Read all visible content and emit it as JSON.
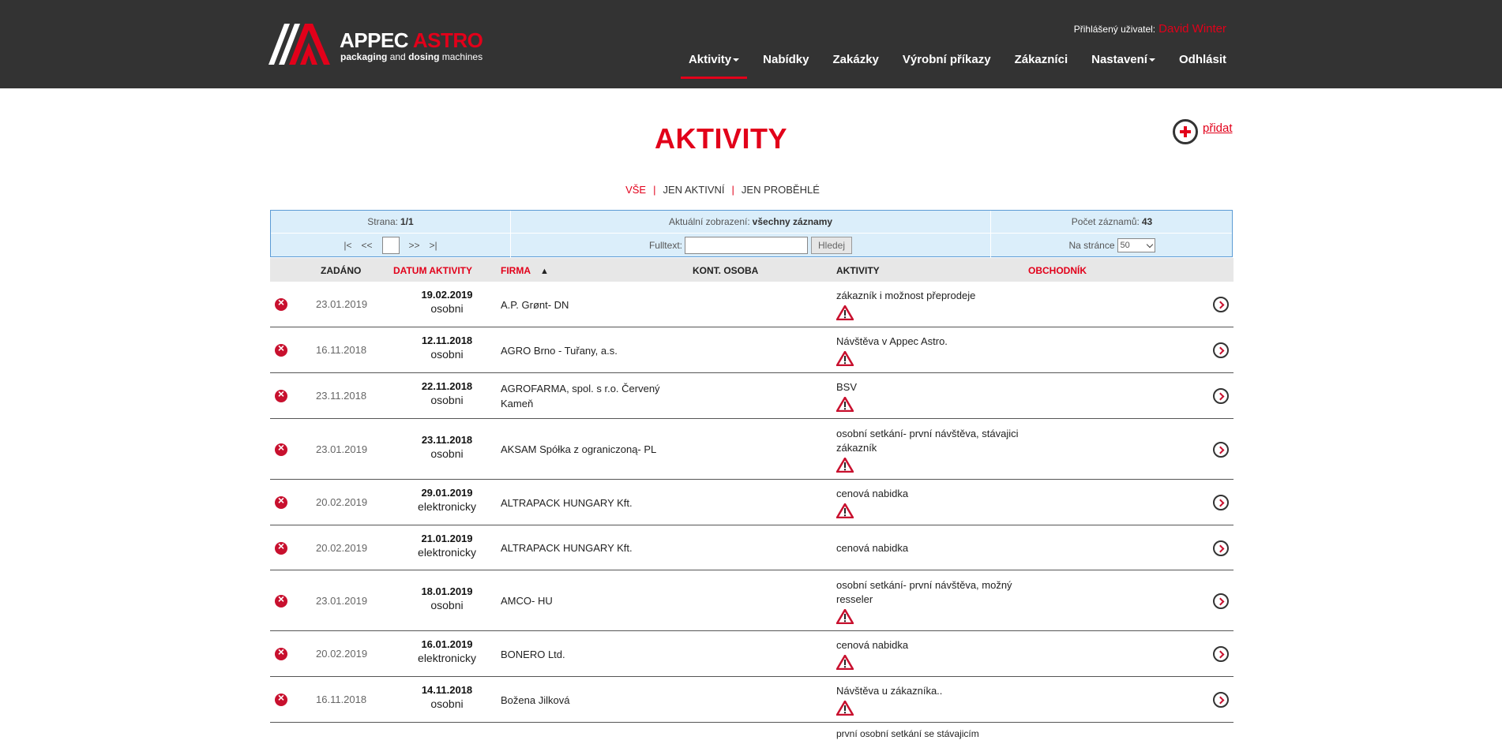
{
  "brand": {
    "name_white": "APPEC",
    "name_red": "ASTRO",
    "sub_bold_1": "packaging",
    "sub_and": "and",
    "sub_bold_2": "dosing",
    "sub_rest": "machines",
    "accent_color": "#e2001a",
    "header_bg": "#333333"
  },
  "user": {
    "label": "Přihlášený uživatel:",
    "name": "David Winter"
  },
  "nav": [
    {
      "label": "Aktivity",
      "active": true,
      "dropdown": true
    },
    {
      "label": "Nabídky"
    },
    {
      "label": "Zakázky"
    },
    {
      "label": "Výrobní příkazy"
    },
    {
      "label": "Zákazníci"
    },
    {
      "label": "Nastavení",
      "dropdown": true
    },
    {
      "label": "Odhlásit"
    }
  ],
  "page": {
    "title": "AKTIVITY",
    "add_label": "přidat"
  },
  "filters": {
    "all": "VŠE",
    "active": "JEN AKTIVNÍ",
    "past": "JEN PROBĚHLÉ",
    "separator": "|"
  },
  "pager": {
    "page_label": "Strana:",
    "page_value": "1/1",
    "view_label": "Aktuální zobrazení:",
    "view_value": "všechny záznamy",
    "count_label": "Počet záznamů:",
    "count_value": "43",
    "first": "|<",
    "prev": "<<",
    "next": ">>",
    "last": ">|",
    "fulltext_label": "Fulltext:",
    "search_button": "Hledej",
    "per_page_label": "Na stránce",
    "per_page_value": "50"
  },
  "table": {
    "headers": {
      "zadano": "ZADÁNO",
      "datum": "DATUM AKTIVITY",
      "firma": "FIRMA",
      "sort_arrow": "▲",
      "osoba": "KONT. OSOBA",
      "aktivity": "AKTIVITY",
      "obchodnik": "OBCHODNÍK"
    },
    "rows": [
      {
        "zadano": "23.01.2019",
        "datum": "19.02.2019",
        "typ": "osobni",
        "firma": [
          "A.P. Grønt- DN"
        ],
        "aktivita": [
          "zákazník i možnost přeprodeje"
        ],
        "warn": true
      },
      {
        "zadano": "16.11.2018",
        "datum": "12.11.2018",
        "typ": "osobni",
        "firma": [
          "AGRO Brno - Tuřany, a.s."
        ],
        "aktivita": [
          "Návštěva v Appec Astro."
        ],
        "warn": true
      },
      {
        "zadano": "23.11.2018",
        "datum": "22.11.2018",
        "typ": "osobni",
        "firma": [
          "AGROFARMA, spol. s r.o. Červený",
          "Kameň"
        ],
        "aktivita": [
          "BSV"
        ],
        "warn": true
      },
      {
        "zadano": "23.01.2019",
        "datum": "23.11.2018",
        "typ": "osobni",
        "firma": [
          "AKSAM Spółka z ograniczoną- PL"
        ],
        "aktivita": [
          "osobní setkání- první návštěva, stávajici",
          "zákazník"
        ],
        "warn": true
      },
      {
        "zadano": "20.02.2019",
        "datum": "29.01.2019",
        "typ": "elektronicky",
        "firma": [
          "ALTRAPACK HUNGARY Kft."
        ],
        "aktivita": [
          "cenová nabidka"
        ],
        "warn": true
      },
      {
        "zadano": "20.02.2019",
        "datum": "21.01.2019",
        "typ": "elektronicky",
        "firma": [
          "ALTRAPACK HUNGARY Kft."
        ],
        "aktivita": [
          "cenová nabidka"
        ],
        "warn": false
      },
      {
        "zadano": "23.01.2019",
        "datum": "18.01.2019",
        "typ": "osobni",
        "firma": [
          "AMCO- HU"
        ],
        "aktivita": [
          "osobní setkání- první návštěva, možný",
          "resseler"
        ],
        "warn": true
      },
      {
        "zadano": "20.02.2019",
        "datum": "16.01.2019",
        "typ": "elektronicky",
        "firma": [
          "BONERO Ltd."
        ],
        "aktivita": [
          "cenová nabidka"
        ],
        "warn": true
      },
      {
        "zadano": "16.11.2018",
        "datum": "14.11.2018",
        "typ": "osobni",
        "firma": [
          "Božena Jilková"
        ],
        "aktivita": [
          "Návštěva u zákazníka.."
        ],
        "warn": true
      }
    ],
    "partial_row_text": "první osobní setkání se stávajicím"
  }
}
